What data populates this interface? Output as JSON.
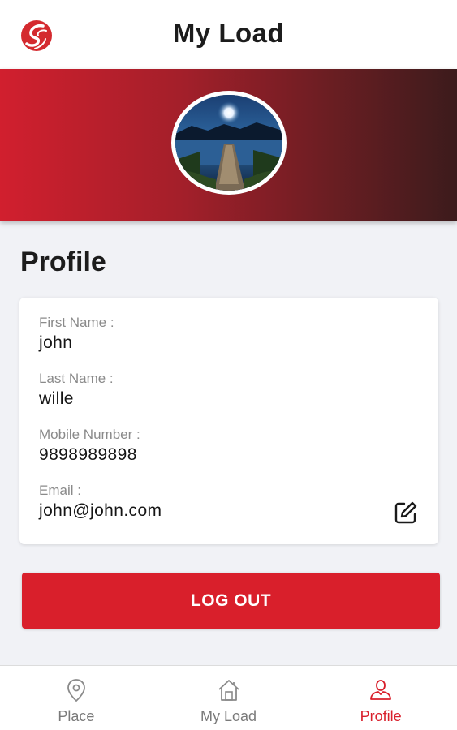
{
  "app_bar": {
    "title": "My Load"
  },
  "profile": {
    "section_title": "Profile",
    "fields": [
      {
        "label": "First Name :",
        "value": "john"
      },
      {
        "label": "Last Name :",
        "value": "wille"
      },
      {
        "label": "Mobile Number :",
        "value": "9898989898"
      },
      {
        "label": "Email :",
        "value": "john@john.com"
      }
    ]
  },
  "actions": {
    "logout_label": "LOG OUT"
  },
  "bottom_nav": {
    "items": [
      {
        "label": "Place",
        "icon": "location-pin-icon",
        "active": false
      },
      {
        "label": "My Load",
        "icon": "home-icon",
        "active": false
      },
      {
        "label": "Profile",
        "icon": "user-icon",
        "active": true
      }
    ]
  },
  "colors": {
    "accent": "#d91f2b",
    "banner_start": "#d11f2e",
    "banner_end": "#3c1b1c"
  }
}
